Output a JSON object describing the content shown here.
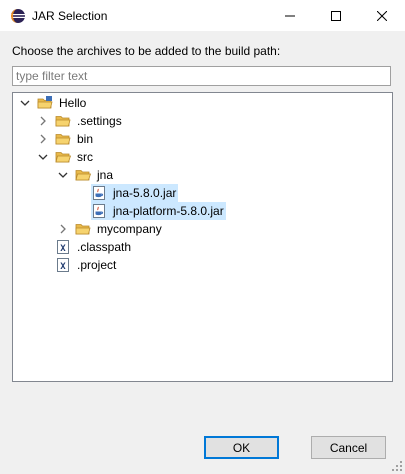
{
  "window": {
    "title": "JAR Selection"
  },
  "dialog": {
    "prompt": "Choose the archives to be added to the build path:",
    "filter_placeholder": "type filter text"
  },
  "tree": {
    "root": "Hello",
    "settings": ".settings",
    "bin": "bin",
    "src": "src",
    "jna": "jna",
    "jar1": "jna-5.8.0.jar",
    "jar2": "jna-platform-5.8.0.jar",
    "mycompany": "mycompany",
    "classpath": ".classpath",
    "project": ".project"
  },
  "buttons": {
    "ok": "OK",
    "cancel": "Cancel"
  },
  "colors": {
    "selection": "#cce8ff",
    "default_button_border": "#0078d7",
    "folder": "#e8b94a"
  }
}
